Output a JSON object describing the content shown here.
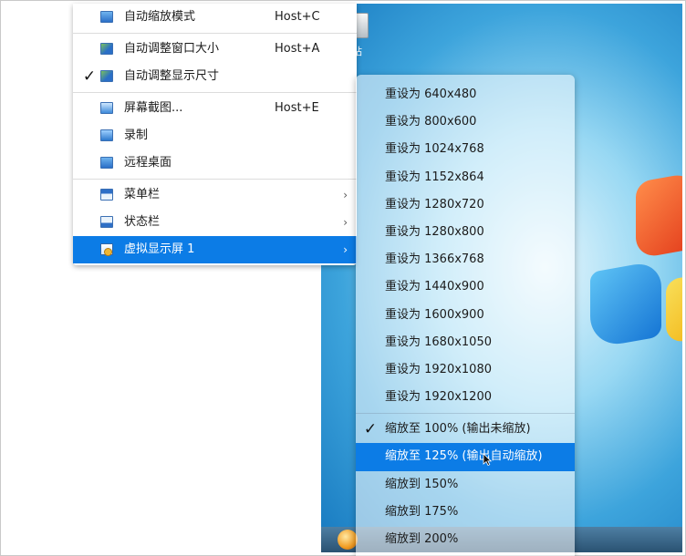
{
  "desktop": {
    "icon_label": "站"
  },
  "main_menu": {
    "items": [
      {
        "label": "自动缩放模式",
        "shortcut": "Host+C",
        "icon": "scale-mode-icon",
        "checked": false
      },
      {
        "label": "自动调整窗口大小",
        "shortcut": "Host+A",
        "icon": "resize-window-icon",
        "checked": false
      },
      {
        "label": "自动调整显示尺寸",
        "shortcut": "",
        "icon": "resize-display-icon",
        "checked": true,
        "check_mark": "✓"
      },
      {
        "label": "屏幕截图...",
        "shortcut": "Host+E",
        "icon": "screenshot-icon",
        "checked": false
      },
      {
        "label": "录制",
        "shortcut": "",
        "icon": "record-icon",
        "checked": false
      },
      {
        "label": "远程桌面",
        "shortcut": "",
        "icon": "remote-desktop-icon",
        "checked": false
      },
      {
        "label": "菜单栏",
        "shortcut": "",
        "icon": "menubar-icon",
        "submenu_arrow": "›"
      },
      {
        "label": "状态栏",
        "shortcut": "",
        "icon": "statusbar-icon",
        "submenu_arrow": "›"
      },
      {
        "label": "虚拟显示屏 1",
        "shortcut": "",
        "icon": "virtual-display-icon",
        "submenu_arrow": "›",
        "selected": true
      }
    ]
  },
  "sub_menu": {
    "resolutions": [
      "重设为 640x480",
      "重设为 800x600",
      "重设为 1024x768",
      "重设为 1152x864",
      "重设为 1280x720",
      "重设为 1280x800",
      "重设为 1366x768",
      "重设为 1440x900",
      "重设为 1600x900",
      "重设为 1680x1050",
      "重设为 1920x1080",
      "重设为 1920x1200"
    ],
    "scales": [
      {
        "label": "缩放至 100% (输出未缩放)",
        "checked": true,
        "check_mark": "✓"
      },
      {
        "label": "缩放至 125% (输出自动缩放)",
        "selected": true
      },
      {
        "label": "缩放到 150%"
      },
      {
        "label": "缩放到 175%"
      },
      {
        "label": "缩放到 200%"
      }
    ]
  },
  "colors": {
    "highlight": "#0c7ce6",
    "menu_bg": "#ffffff"
  }
}
